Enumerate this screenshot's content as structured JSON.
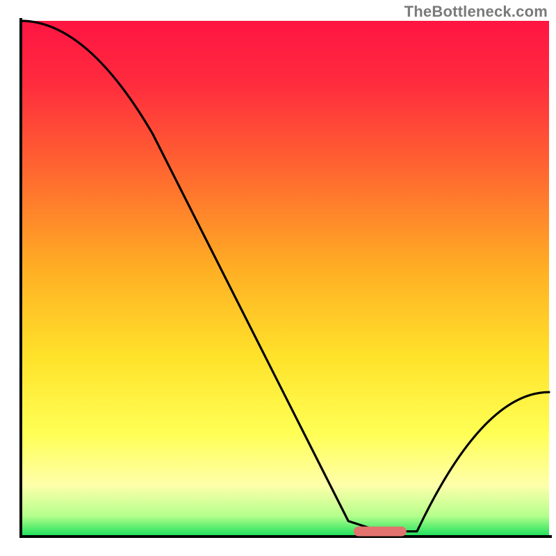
{
  "watermark": "TheBottleneck.com",
  "chart_data": {
    "type": "line",
    "title": "",
    "xlabel": "",
    "ylabel": "",
    "xlim": [
      0,
      100
    ],
    "ylim": [
      0,
      100
    ],
    "x": [
      0,
      25,
      62,
      68,
      75,
      100
    ],
    "values": [
      100,
      78,
      3,
      1,
      1,
      28
    ],
    "marker": {
      "x_start": 63,
      "x_end": 73,
      "y": 1
    },
    "background_gradient": {
      "stops": [
        {
          "offset": 0.0,
          "color": "#ff1543"
        },
        {
          "offset": 0.12,
          "color": "#ff2b3e"
        },
        {
          "offset": 0.3,
          "color": "#ff6a2f"
        },
        {
          "offset": 0.48,
          "color": "#ffae24"
        },
        {
          "offset": 0.65,
          "color": "#ffe22a"
        },
        {
          "offset": 0.8,
          "color": "#ffff55"
        },
        {
          "offset": 0.9,
          "color": "#ffffaa"
        },
        {
          "offset": 0.96,
          "color": "#b4ff8c"
        },
        {
          "offset": 1.0,
          "color": "#18e05a"
        }
      ]
    },
    "axis_color": "#000000",
    "line_color": "#000000",
    "marker_color": "#e2736e"
  }
}
